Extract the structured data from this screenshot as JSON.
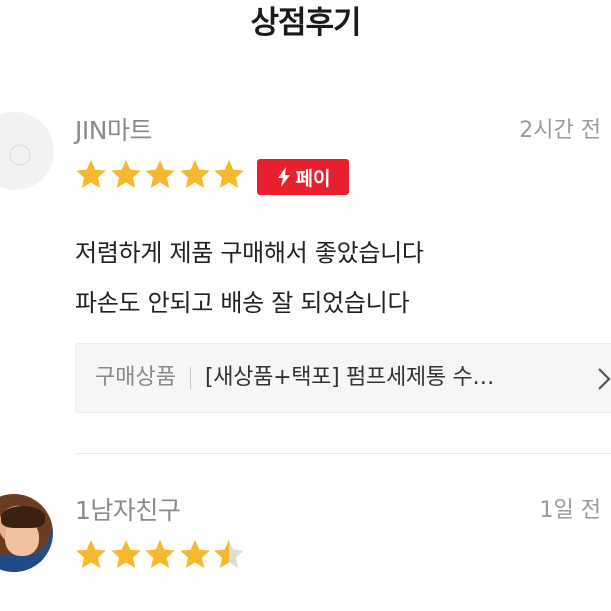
{
  "header": {
    "title": "상점후기"
  },
  "reviews": [
    {
      "author": "JIN마트",
      "time": "2시간 전",
      "rating": 5,
      "badge": "페이",
      "text_lines": [
        "저렴하게 제품 구매해서 좋았습니다",
        "파손도 안되고 배송 잘 되었습니다"
      ],
      "product_label": "구매상품",
      "product_name": "[새상품+택포] 펌프세제통 수…"
    },
    {
      "author": "1남자친구",
      "time": "1일 전",
      "rating": 4.5
    }
  ],
  "colors": {
    "star": "#f5b82e",
    "star_empty": "#dddddd",
    "badge": "#e8202e"
  },
  "icons": {
    "star": "star-icon",
    "pay": "lightning-icon",
    "chevron": "chevron-right-icon"
  }
}
